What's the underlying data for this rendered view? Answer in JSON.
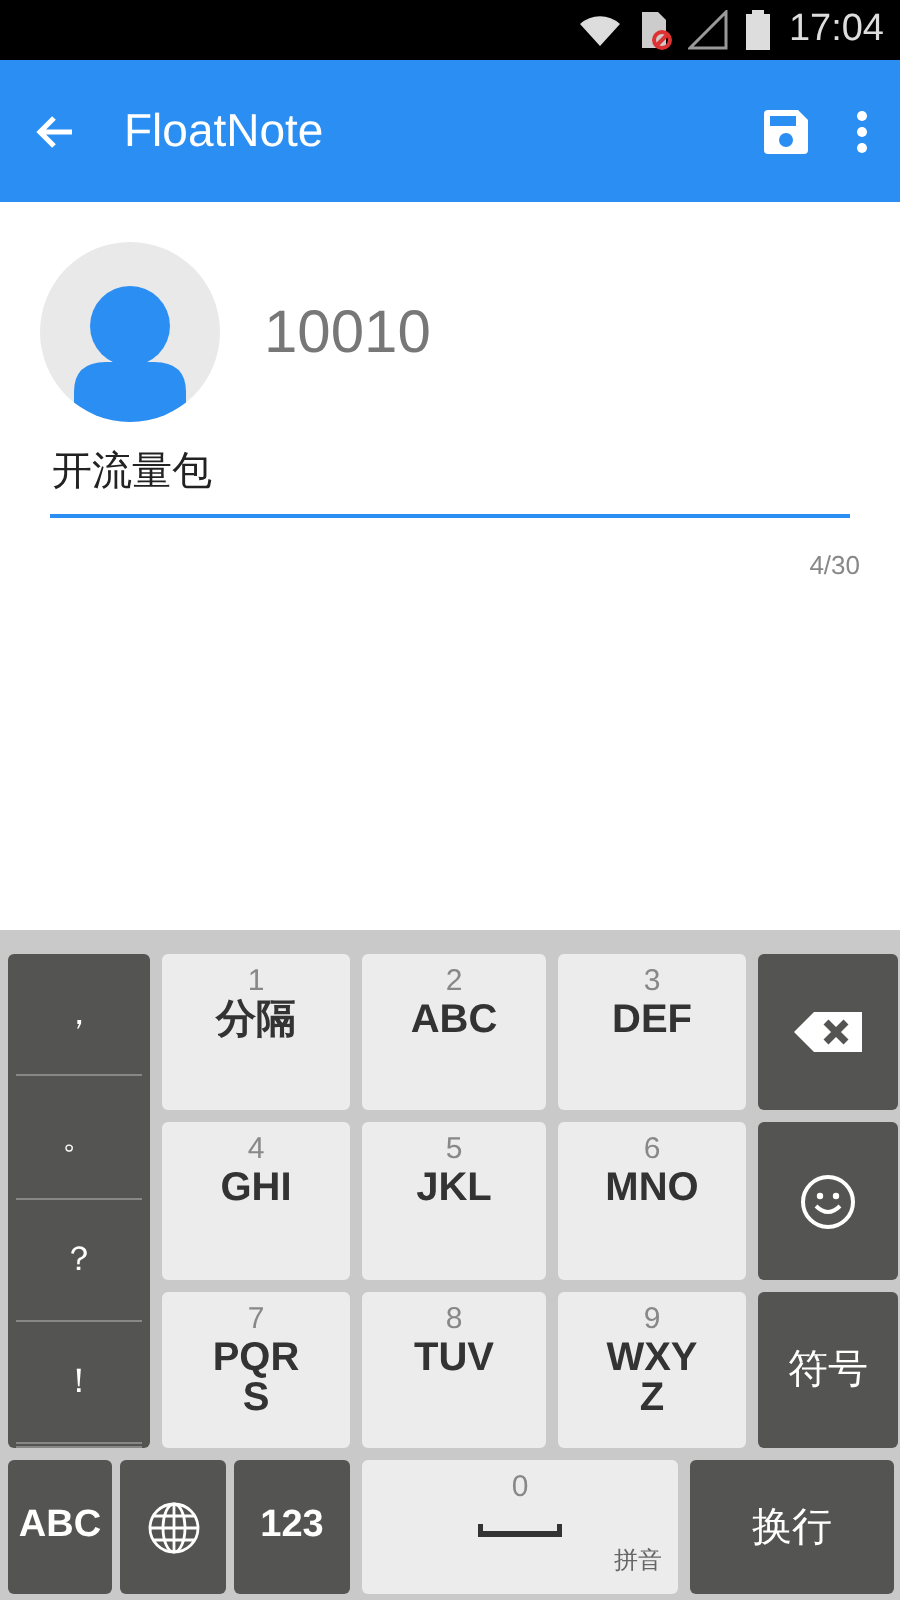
{
  "status_bar": {
    "time": "17:04"
  },
  "app_bar": {
    "title": "FloatNote"
  },
  "contact": {
    "name": "10010"
  },
  "message": {
    "value": "开流量包",
    "counter": "4/30"
  },
  "keyboard": {
    "punctuation": [
      "，",
      "。",
      "？",
      "！"
    ],
    "keys": [
      {
        "digit": "1",
        "letters": "分隔"
      },
      {
        "digit": "2",
        "letters": "ABC"
      },
      {
        "digit": "3",
        "letters": "DEF"
      },
      {
        "digit": "4",
        "letters": "GHI"
      },
      {
        "digit": "5",
        "letters": "JKL"
      },
      {
        "digit": "6",
        "letters": "MNO"
      },
      {
        "digit": "7",
        "letters": "PQRS"
      },
      {
        "digit": "8",
        "letters": "TUV"
      },
      {
        "digit": "9",
        "letters": "WXYZ"
      }
    ],
    "symbol_key": "符号",
    "bottom_row": [
      {
        "kind": "text",
        "label": "ABC"
      },
      {
        "kind": "globe"
      },
      {
        "kind": "text",
        "label": "123"
      },
      {
        "kind": "space",
        "digit": "0",
        "label": "拼音"
      },
      {
        "kind": "enter",
        "label": "换行"
      }
    ]
  }
}
